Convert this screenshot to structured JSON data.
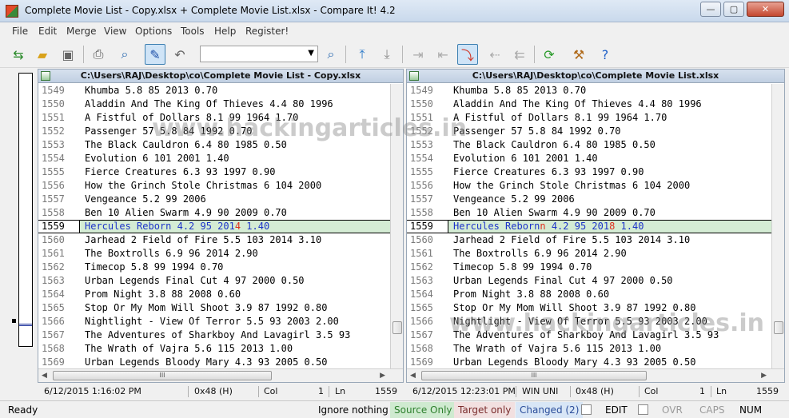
{
  "window": {
    "title": "Complete Movie List - Copy.xlsx + Complete Movie List.xlsx - Compare It! 4.2",
    "minimize": "—",
    "maximize": "▢",
    "close": "✕"
  },
  "menu": [
    "File",
    "Edit",
    "Merge",
    "View",
    "Options",
    "Tools",
    "Help",
    "Register!"
  ],
  "toolbar": {
    "search_value": "",
    "icons": [
      "open-files-icon",
      "open-folder-icon",
      "save-icon",
      "print-icon",
      "print-preview-icon",
      "edit-icon",
      "undo-icon",
      "find-icon",
      "first-diff-icon",
      "last-diff-icon",
      "copy-left-icon",
      "copy-right-icon",
      "next-diff-icon",
      "prev-diff-icon",
      "copy-block-icon",
      "refresh-icon",
      "settings-icon",
      "help-icon"
    ]
  },
  "left_pane": {
    "path": "C:\\Users\\RAJ\\Desktop\\co\\Complete Movie List - Copy.xlsx",
    "rows": [
      {
        "num": "1549",
        "text": "Khumba  5.8 85  2013    0.70"
      },
      {
        "num": "1550",
        "text": "Aladdin And The King Of Thieves 4.4 80  1996"
      },
      {
        "num": "1551",
        "text": "A Fistful of Dollars    8.1 99  1964    1.70"
      },
      {
        "num": "1552",
        "text": "Passenger 57    5.8 84  1992    0.70"
      },
      {
        "num": "1553",
        "text": "The Black Cauldron  6.4 80  1985    0.50"
      },
      {
        "num": "1554",
        "text": "Evolution   6   101 2001    1.40"
      },
      {
        "num": "1555",
        "text": "Fierce Creatures    6.3 93  1997    0.90"
      },
      {
        "num": "1556",
        "text": "How the Grinch Stole Christmas  6   104 2000"
      },
      {
        "num": "1557",
        "text": "Vengeance   5.2 99  2006"
      },
      {
        "num": "1558",
        "text": "Ben 10 Alien Swarm  4.9 90  2009    0.70"
      },
      {
        "num": "1559",
        "text_pre": "Hercules Reborn 4.2 95  201",
        "text_diff": "4",
        "text_post": "    1.40",
        "changed": true
      },
      {
        "num": "1560",
        "text": "Jarhead 2  Field of Fire     5.5 103 2014    3.10"
      },
      {
        "num": "1561",
        "text": "The Boxtrolls   6.9 96  2014    2.90"
      },
      {
        "num": "1562",
        "text": "Timecop 5.8 99  1994    0.70"
      },
      {
        "num": "1563",
        "text": "Urban Legends Final Cut 4   97  2000    0.50"
      },
      {
        "num": "1564",
        "text": "Prom Night  3.8 88  2008    0.60"
      },
      {
        "num": "1565",
        "text": "Stop Or My Mom Will Shoot   3.9 87  1992    0.80"
      },
      {
        "num": "1566",
        "text": "Nightlight - View Of Terror 5.5 93  2003    2.00"
      },
      {
        "num": "1567",
        "text": "The Adventures of Sharkboy And Lavagirl 3.5 93"
      },
      {
        "num": "1568",
        "text": "The Wrath of Vajra  5.6 115 2013    1.00"
      },
      {
        "num": "1569",
        "text": "Urban Legends Bloody Mary   4.3 93  2005    0.50"
      }
    ],
    "hscroll_thumb": "III",
    "status": {
      "time": "6/12/2015  1:16:02 PM",
      "encoding": "",
      "hex": "0x48 (H)",
      "col_label": "Col",
      "col": "1",
      "ln_label": "Ln",
      "ln": "1559"
    }
  },
  "right_pane": {
    "path": "C:\\Users\\RAJ\\Desktop\\co\\Complete Movie List.xlsx",
    "rows": [
      {
        "num": "1549",
        "text": "Khumba  5.8 85  2013    0.70"
      },
      {
        "num": "1550",
        "text": "Aladdin And The King Of Thieves 4.4 80  1996"
      },
      {
        "num": "1551",
        "text": "A Fistful of Dollars    8.1 99  1964    1.70"
      },
      {
        "num": "1552",
        "text": "Passenger 57    5.8 84  1992    0.70"
      },
      {
        "num": "1553",
        "text": "The Black Cauldron  6.4 80  1985    0.50"
      },
      {
        "num": "1554",
        "text": "Evolution   6   101 2001    1.40"
      },
      {
        "num": "1555",
        "text": "Fierce Creatures    6.3 93  1997    0.90"
      },
      {
        "num": "1556",
        "text": "How the Grinch Stole Christmas  6   104 2000"
      },
      {
        "num": "1557",
        "text": "Vengeance   5.2 99  2006"
      },
      {
        "num": "1558",
        "text": "Ben 10 Alien Swarm  4.9 90  2009    0.70"
      },
      {
        "num": "1559",
        "text_pre": "Hercules Reborn",
        "text_diff": "n",
        "text_mid": "   4.2 95  201",
        "text_diff2": "8",
        "text_post": "    1.40",
        "changed": true
      },
      {
        "num": "1560",
        "text": "Jarhead 2  Field of Fire     5.5 103 2014    3.10"
      },
      {
        "num": "1561",
        "text": "The Boxtrolls   6.9 96  2014    2.90"
      },
      {
        "num": "1562",
        "text": "Timecop 5.8 99  1994    0.70"
      },
      {
        "num": "1563",
        "text": "Urban Legends Final Cut 4   97  2000    0.50"
      },
      {
        "num": "1564",
        "text": "Prom Night  3.8 88  2008    0.60"
      },
      {
        "num": "1565",
        "text": "Stop Or My Mom Will Shoot   3.9 87  1992    0.80"
      },
      {
        "num": "1566",
        "text": "Nightlight - View Of Terror 5.5 93  2003    2.00"
      },
      {
        "num": "1567",
        "text": "The Adventures of Sharkboy And Lavagirl 3.5 93"
      },
      {
        "num": "1568",
        "text": "The Wrath of Vajra  5.6 115 2013    1.00"
      },
      {
        "num": "1569",
        "text": "Urban Legends Bloody Mary   4.3 93  2005    0.50"
      }
    ],
    "hscroll_thumb": "III",
    "status": {
      "time": "6/12/2015  12:23:01 PM",
      "encoding": "WIN UNI",
      "hex": "0x48 (H)",
      "col_label": "Col",
      "col": "1",
      "ln_label": "Ln",
      "ln": "1559"
    }
  },
  "statusbar": {
    "ready": "Ready",
    "ignore": "Ignore nothing",
    "source_only": "Source Only",
    "target_only": "Target only",
    "changed": "Changed (2)",
    "edit": "EDIT",
    "ovr": "OVR",
    "caps": "CAPS",
    "num": "NUM"
  },
  "watermark": "www.hackingarticles.in",
  "colors": {
    "changed_row_bg": "#d4ecd4",
    "changed_text": "#1d34c9",
    "diff_char": "#e0301e"
  }
}
